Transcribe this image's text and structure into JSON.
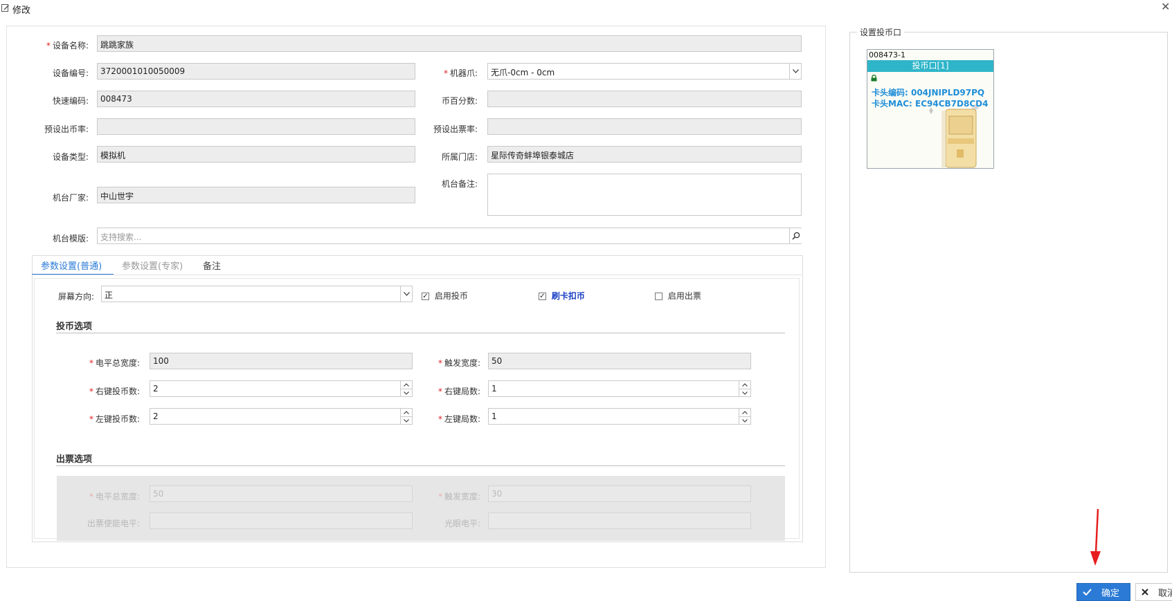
{
  "window": {
    "title": "修改"
  },
  "form": {
    "device_name": {
      "label": "设备名称:",
      "value": "跳跳家族"
    },
    "device_no": {
      "label": "设备编号:",
      "value": "3720001010050009"
    },
    "claw": {
      "label": "机器爪:",
      "value": "无爪-0cm - 0cm"
    },
    "quick_code": {
      "label": "快速编码:",
      "value": "008473"
    },
    "coin_ratio": {
      "label": "币百分数:",
      "value": ""
    },
    "preset_coin_rate": {
      "label": "预设出币率:",
      "value": ""
    },
    "preset_ticket_rate": {
      "label": "预设出票率:",
      "value": ""
    },
    "device_type": {
      "label": "设备类型:",
      "value": "模拟机"
    },
    "store": {
      "label": "所属门店:",
      "value": "星际传奇蚌埠银泰城店"
    },
    "manufacturer": {
      "label": "机台厂家:",
      "value": "中山世宇"
    },
    "remark": {
      "label": "机台备注:",
      "value": ""
    },
    "template": {
      "label": "机台模版:",
      "placeholder": "支持搜索..."
    }
  },
  "tabs": [
    {
      "label": "参数设置(普通)",
      "active": true
    },
    {
      "label": "参数设置(专家)",
      "active": false
    },
    {
      "label": "备注",
      "active": false
    }
  ],
  "settings": {
    "screen": {
      "label": "屏幕方向:",
      "value": "正"
    },
    "enable_coin": {
      "label": "启用投币",
      "checked": true
    },
    "card_deduct": {
      "label": "刷卡扣币",
      "checked": true
    },
    "enable_ticket": {
      "label": "启用出票",
      "checked": false
    }
  },
  "coin_section": {
    "title": "投币选项",
    "level_width": {
      "label": "电平总宽度:",
      "value": "100"
    },
    "trigger_width": {
      "label": "触发宽度:",
      "value": "50"
    },
    "right_coins": {
      "label": "右键投币数:",
      "value": "2"
    },
    "right_rounds": {
      "label": "右键局数:",
      "value": "1"
    },
    "left_coins": {
      "label": "左键投币数:",
      "value": "2"
    },
    "left_rounds": {
      "label": "左键局数:",
      "value": "1"
    }
  },
  "ticket_section": {
    "title": "出票选项",
    "level_width": {
      "label": "电平总宽度:",
      "value": "50"
    },
    "trigger_width": {
      "label": "触发宽度:",
      "value": "30"
    },
    "enable_level": {
      "label": "出票使能电平:",
      "value": ""
    },
    "optical_level": {
      "label": "光眼电平:",
      "value": ""
    }
  },
  "coin_slot_panel": {
    "legend": "设置投币口",
    "card": {
      "id": "008473-1",
      "header": "投币口[1]",
      "line1": "卡头编码: 004JNIPLD97PQ",
      "line2": "卡头MAC: EC94CB7D8CD4"
    }
  },
  "buttons": {
    "ok": "确定",
    "cancel": "取消"
  },
  "colors": {
    "accent": "#2b7bd6",
    "card_header": "#2fb5c9",
    "required": "#e02020"
  }
}
